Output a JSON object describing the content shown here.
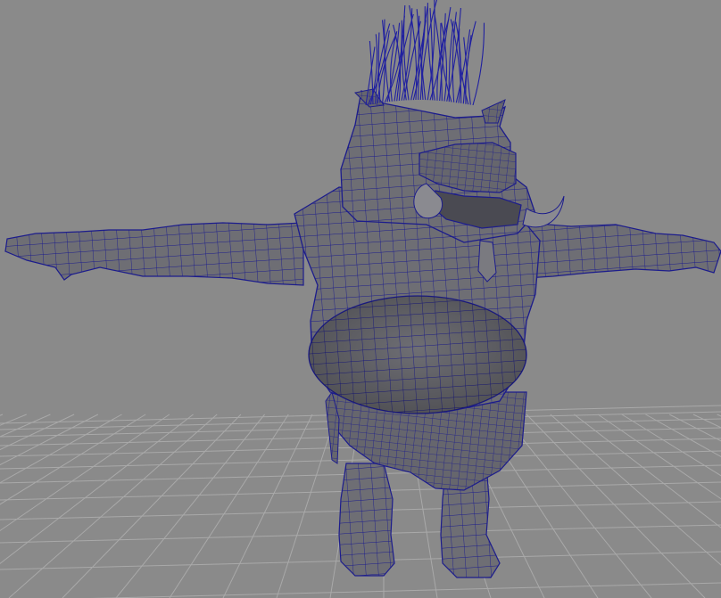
{
  "viewport": {
    "colors": {
      "background": "#8a8a8a",
      "grid": "#a9a9a9",
      "mesh_fill": "#6e6e74",
      "mesh_shade": "#55555c",
      "wire": "#1c1c8c",
      "hair": "#2020a0"
    }
  }
}
